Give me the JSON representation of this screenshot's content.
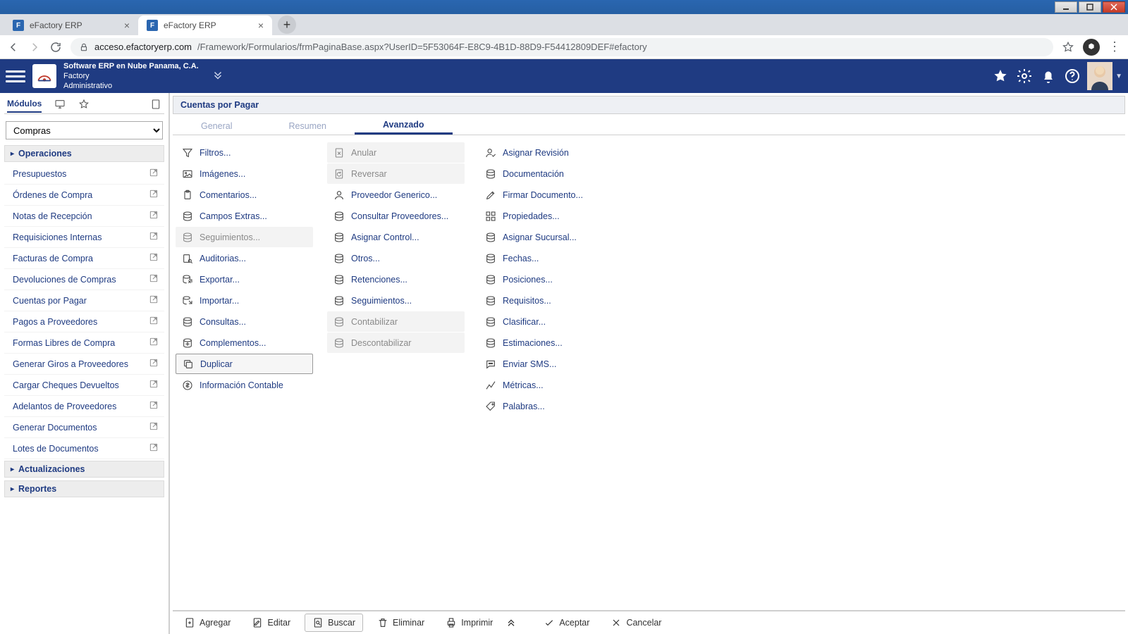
{
  "window": {
    "tabs": [
      {
        "title": "eFactory ERP",
        "active": false
      },
      {
        "title": "eFactory ERP",
        "active": true
      }
    ],
    "url_host": "acceso.efactoryerp.com",
    "url_path": "/Framework/Formularios/frmPaginaBase.aspx?UserID=5F53064F-E8C9-4B1D-88D9-F54412809DEF#efactory"
  },
  "app_header": {
    "company": "Software ERP en Nube Panama, C.A.",
    "product": "Factory",
    "module": "Administrativo"
  },
  "sidebar": {
    "tab_label": "Módulos",
    "module_select": "Compras",
    "sections": {
      "operaciones": "Operaciones",
      "actualizaciones": "Actualizaciones",
      "reportes": "Reportes"
    },
    "items": [
      "Presupuestos",
      "Órdenes de Compra",
      "Notas de Recepción",
      "Requisiciones Internas",
      "Facturas de Compra",
      "Devoluciones de Compras",
      "Cuentas por Pagar",
      "Pagos a Proveedores",
      "Formas Libres de Compra",
      "Generar Giros a Proveedores",
      "Cargar Cheques Devueltos",
      "Adelantos de Proveedores",
      "Generar Documentos",
      "Lotes de Documentos"
    ]
  },
  "panel": {
    "title": "Cuentas por Pagar",
    "tabs": {
      "general": "General",
      "resumen": "Resumen",
      "avanzado": "Avanzado"
    },
    "columns": [
      [
        {
          "label": "Filtros...",
          "icon": "funnel",
          "disabled": false
        },
        {
          "label": "Imágenes...",
          "icon": "image",
          "disabled": false
        },
        {
          "label": "Comentarios...",
          "icon": "clipboard",
          "disabled": false
        },
        {
          "label": "Campos Extras...",
          "icon": "db",
          "disabled": false
        },
        {
          "label": "Seguimientos...",
          "icon": "db",
          "disabled": true
        },
        {
          "label": "Auditorias...",
          "icon": "audit",
          "disabled": false
        },
        {
          "label": "Exportar...",
          "icon": "export",
          "disabled": false
        },
        {
          "label": "Importar...",
          "icon": "import",
          "disabled": false
        },
        {
          "label": "Consultas...",
          "icon": "db",
          "disabled": false
        },
        {
          "label": "Complementos...",
          "icon": "plugin",
          "disabled": false
        },
        {
          "label": "Duplicar",
          "icon": "copy",
          "disabled": false,
          "highlight": true
        },
        {
          "label": "Información Contable",
          "icon": "money",
          "disabled": false
        }
      ],
      [
        {
          "label": "Anular",
          "icon": "doc-x",
          "disabled": true
        },
        {
          "label": "Reversar",
          "icon": "doc-r",
          "disabled": true
        },
        {
          "label": "Proveedor Generico...",
          "icon": "person",
          "disabled": false
        },
        {
          "label": "Consultar Proveedores...",
          "icon": "db",
          "disabled": false
        },
        {
          "label": "Asignar Control...",
          "icon": "db",
          "disabled": false
        },
        {
          "label": "Otros...",
          "icon": "db",
          "disabled": false
        },
        {
          "label": "Retenciones...",
          "icon": "db",
          "disabled": false
        },
        {
          "label": "Seguimientos...",
          "icon": "db",
          "disabled": false
        },
        {
          "label": "Contabilizar",
          "icon": "db",
          "disabled": true
        },
        {
          "label": "Descontabilizar",
          "icon": "db",
          "disabled": true
        }
      ],
      [
        {
          "label": "Asignar Revisión",
          "icon": "person-check",
          "disabled": false
        },
        {
          "label": "Documentación",
          "icon": "db",
          "disabled": false
        },
        {
          "label": "Firmar Documento...",
          "icon": "pen",
          "disabled": false
        },
        {
          "label": "Propiedades...",
          "icon": "grid",
          "disabled": false
        },
        {
          "label": "Asignar Sucursal...",
          "icon": "db",
          "disabled": false
        },
        {
          "label": "Fechas...",
          "icon": "db",
          "disabled": false
        },
        {
          "label": "Posiciones...",
          "icon": "db",
          "disabled": false
        },
        {
          "label": "Requisitos...",
          "icon": "db",
          "disabled": false
        },
        {
          "label": "Clasificar...",
          "icon": "db",
          "disabled": false
        },
        {
          "label": "Estimaciones...",
          "icon": "db",
          "disabled": false
        },
        {
          "label": "Enviar SMS...",
          "icon": "sms",
          "disabled": false
        },
        {
          "label": "Métricas...",
          "icon": "metrics",
          "disabled": false
        },
        {
          "label": "Palabras...",
          "icon": "tag",
          "disabled": false
        }
      ]
    ]
  },
  "actions": {
    "agregar": "Agregar",
    "editar": "Editar",
    "buscar": "Buscar",
    "eliminar": "Eliminar",
    "imprimir": "Imprimir",
    "aceptar": "Aceptar",
    "cancelar": "Cancelar"
  }
}
